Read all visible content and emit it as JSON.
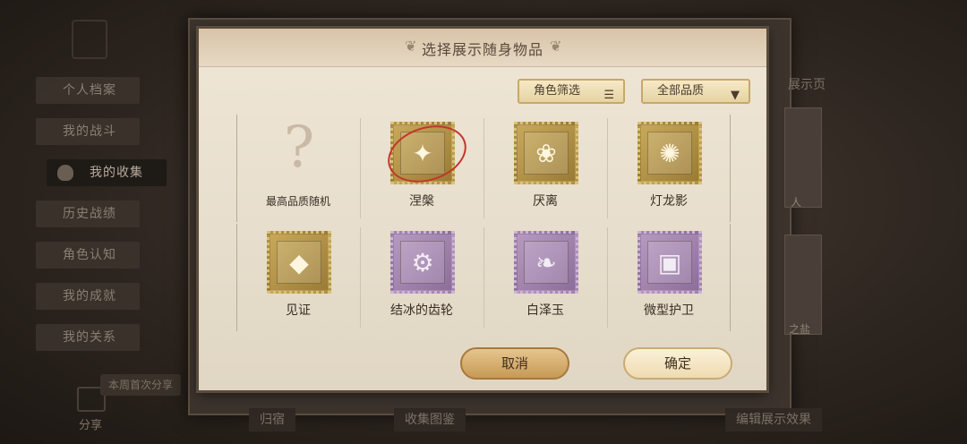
{
  "background": {
    "nav_items": [
      "个人档案",
      "我的战斗",
      "我的收集",
      "历史战绩",
      "角色认知",
      "我的成就",
      "我的关系"
    ],
    "active_nav": "我的收集",
    "weekly_share": "本周首次分享",
    "share_label": "分享",
    "bottom_tabs": [
      "归宿",
      "收集图鉴",
      "编辑展示效果"
    ],
    "right_title": "展示页",
    "right_card_texts": [
      "人",
      "之盐"
    ]
  },
  "dialog": {
    "title": "选择展示随身物品",
    "filter_role": "角色筛选",
    "filter_quality": "全部品质",
    "items": [
      {
        "label": "最高品质随机",
        "style": "random",
        "icon": "question-mark"
      },
      {
        "label": "涅槃",
        "style": "gold",
        "icon": "phoenix",
        "selected": true
      },
      {
        "label": "厌离",
        "style": "gold",
        "icon": "blossom"
      },
      {
        "label": "灯龙影",
        "style": "gold",
        "icon": "lantern"
      },
      {
        "label": "见证",
        "style": "gold",
        "icon": "crystal"
      },
      {
        "label": "结冰的齿轮",
        "style": "purple",
        "icon": "frozen-gear"
      },
      {
        "label": "白泽玉",
        "style": "purple",
        "icon": "jade"
      },
      {
        "label": "微型护卫",
        "style": "purple",
        "icon": "guard-box"
      }
    ],
    "cancel": "取消",
    "confirm": "确定"
  },
  "colors": {
    "gold_stamp": "#c8a95a",
    "purple_stamp": "#b699c0",
    "selected_ring": "#c3362b"
  }
}
